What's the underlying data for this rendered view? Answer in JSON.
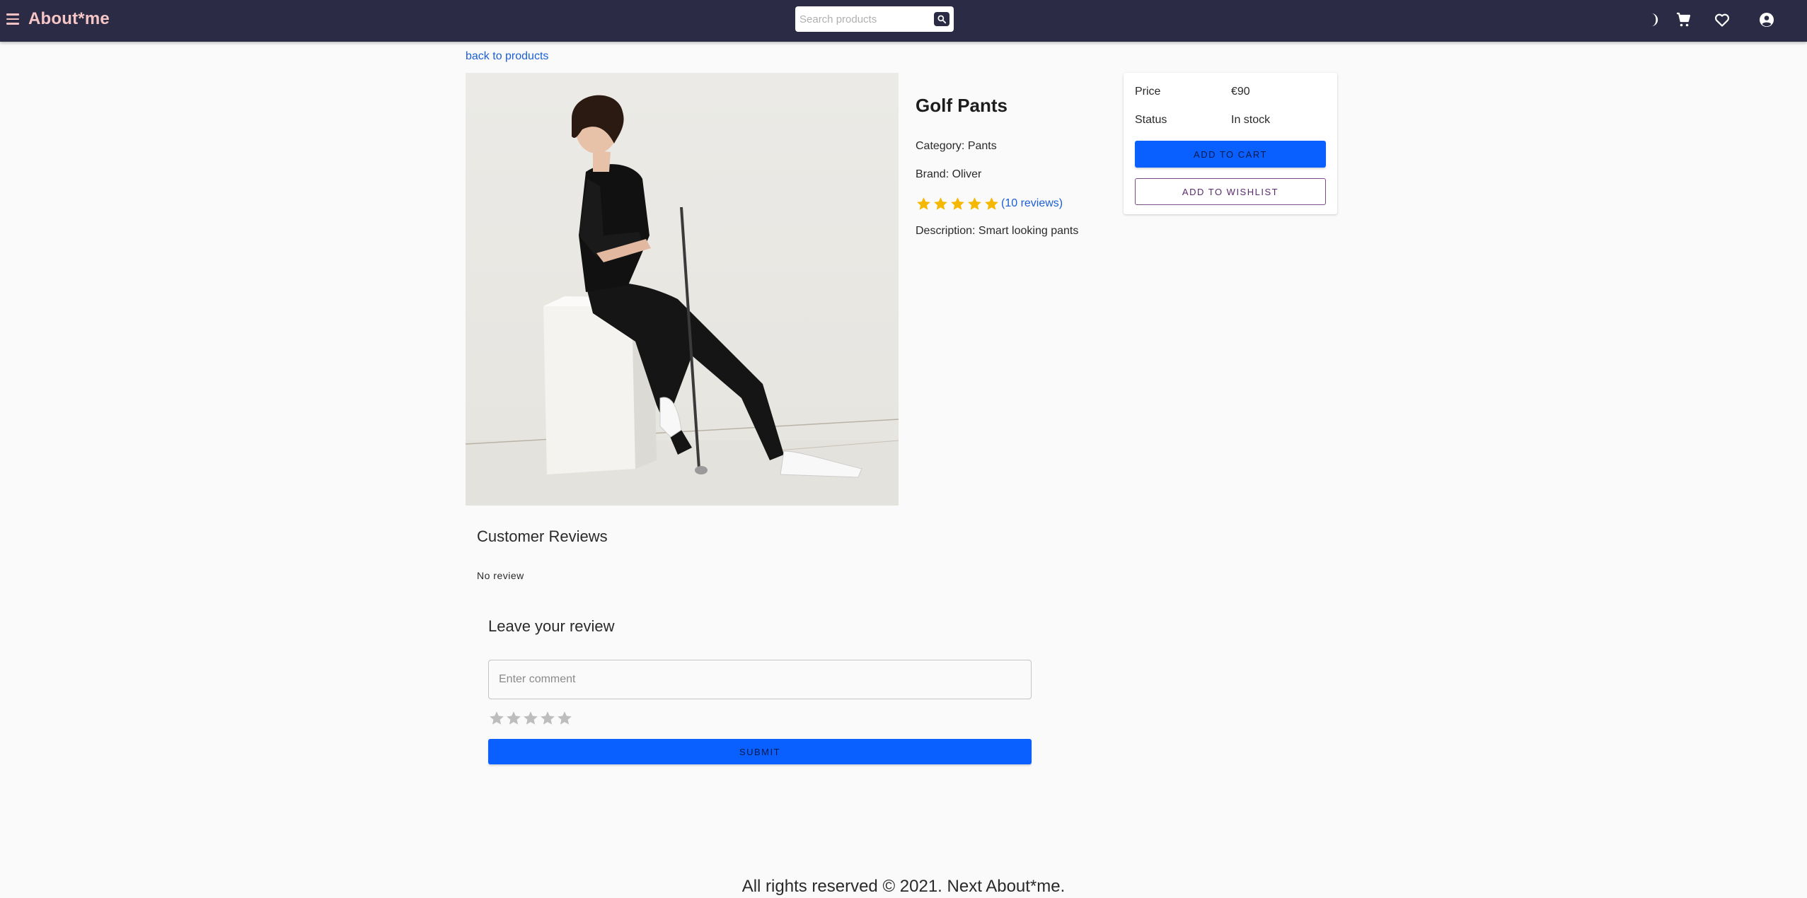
{
  "header": {
    "brand": "About*me",
    "search_placeholder": "Search products",
    "icons": [
      "menu-icon",
      "theme-toggle-icon",
      "cart-icon",
      "heart-icon",
      "account-icon"
    ],
    "bar_color": "#2b2b45",
    "brand_color": "#f6c6c6"
  },
  "nav": {
    "back_link": "back to products"
  },
  "product": {
    "title": "Golf Pants",
    "category": "Category: Pants",
    "brand": "Brand: Oliver",
    "rating": 5,
    "rating_max": 5,
    "reviews_link": "(10 reviews)",
    "description": "Description: Smart looking pants",
    "star_color": "#f5b800"
  },
  "purchase_card": {
    "price_label": "Price",
    "price_value": "€90",
    "status_label": "Status",
    "status_value": "In stock",
    "add_to_cart": "ADD TO CART",
    "add_to_wishlist": "ADD TO WISHLIST",
    "primary_color": "#0a5fff"
  },
  "reviews": {
    "title": "Customer Reviews",
    "empty_text": "No review",
    "form_title": "Leave your review",
    "comment_placeholder": "Enter comment",
    "selected_rating": 0,
    "submit_label": "SUBMIT"
  },
  "footer": {
    "text": "All rights reserved © 2021. Next About*me."
  }
}
